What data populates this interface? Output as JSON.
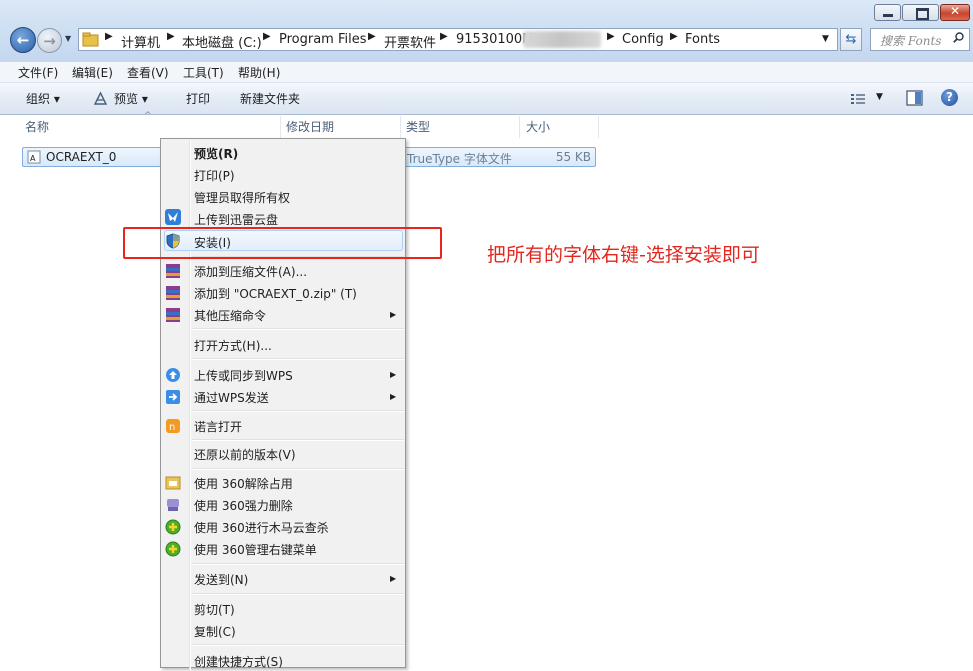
{
  "titlebar": {
    "min_label": "",
    "max_label": "",
    "close_label": ""
  },
  "address": {
    "crumbs": [
      "计算机",
      "本地磁盘 (C:)",
      "Program Files",
      "开票软件",
      "91530100M",
      "Config",
      "Fonts"
    ]
  },
  "search": {
    "placeholder": "搜索 Fonts"
  },
  "menubar": {
    "items": [
      "文件(F)",
      "编辑(E)",
      "查看(V)",
      "工具(T)",
      "帮助(H)"
    ]
  },
  "toolbar": {
    "organize": "组织 ▾",
    "preview": "预览 ▾",
    "print": "打印",
    "new_folder": "新建文件夹"
  },
  "columns": {
    "name": "名称",
    "modified": "修改日期",
    "type": "类型",
    "size": "大小"
  },
  "file": {
    "name": "OCRAEXT_0",
    "type": "TrueType 字体文件",
    "size": "55 KB"
  },
  "context_menu": {
    "preview": "预览(R)",
    "print": "打印(P)",
    "take_ownership": "管理员取得所有权",
    "upload_xunlei": "上传到迅雷云盘",
    "install": "安装(I)",
    "add_archive": "添加到压缩文件(A)...",
    "add_zip": "添加到 \"OCRAEXT_0.zip\" (T)",
    "other_compress": "其他压缩命令",
    "open_with": "打开方式(H)...",
    "wps_sync": "上传或同步到WPS",
    "wps_send": "通过WPS发送",
    "nuoyan_open": "诺言打开",
    "restore_versions": "还原以前的版本(V)",
    "unlock_360": "使用 360解除占用",
    "force_delete_360": "使用 360强力删除",
    "trojan_scan_360": "使用 360进行木马云查杀",
    "manage_menu_360": "使用 360管理右键菜单",
    "send_to": "发送到(N)",
    "cut": "剪切(T)",
    "copy": "复制(C)",
    "create_shortcut": "创建快捷方式(S)"
  },
  "annotation": {
    "text": "把所有的字体右键-选择安装即可",
    "color": "#e3271f"
  },
  "colors": {
    "highlight_border": "#aecff7",
    "annotation_box": "#e8261d",
    "toolbar_bg": "#e4ecf6"
  }
}
